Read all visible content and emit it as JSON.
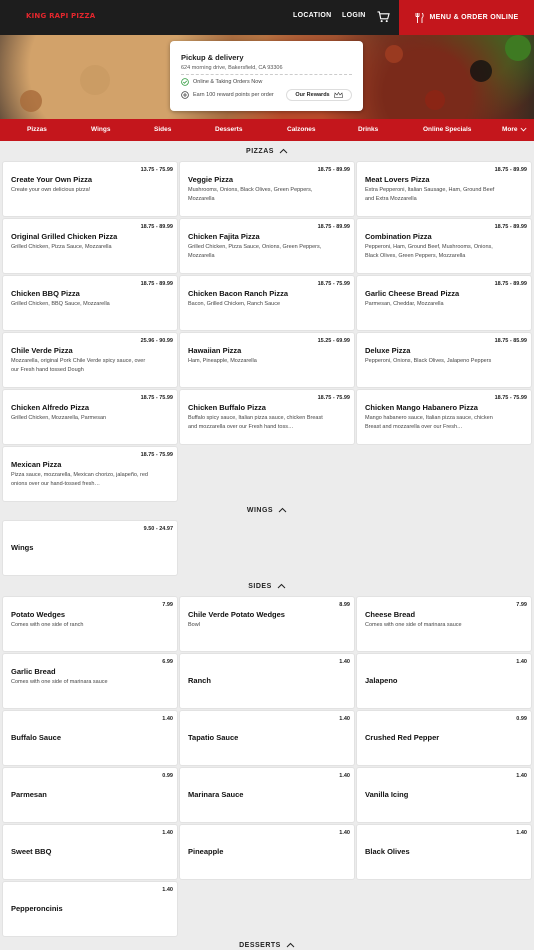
{
  "header": {
    "logo": "KING RAPI PIZZA",
    "nav": [
      "LOCATION",
      "LOGIN"
    ],
    "order_button": "MENU & ORDER ONLINE"
  },
  "store": {
    "title": "Pickup & delivery",
    "address": "624 morning drive, Bakersfield, CA 93306",
    "status": "Online & Taking Orders Now",
    "reward_text": "Earn 100 reward points per order",
    "rewards_button": "Our Rewards"
  },
  "categories": [
    "Pizzas",
    "Wings",
    "Sides",
    "Desserts",
    "Calzones",
    "Drinks",
    "Online Specials",
    "More"
  ],
  "sections": {
    "pizzas": "PIZZAS",
    "wings": "WINGS",
    "sides": "SIDES",
    "desserts": "DESSERTS"
  },
  "pizzas": [
    {
      "name": "Create Your Own Pizza",
      "price": "13.75 - 75.99",
      "desc": "Create your own delicious pizza!"
    },
    {
      "name": "Veggie Pizza",
      "price": "18.75 - 89.99",
      "desc": "Mushrooms, Onions, Black Olives, Green Peppers, Mozzarella"
    },
    {
      "name": "Meat Lovers Pizza",
      "price": "18.75 - 89.99",
      "desc": "Extra Pepperoni, Italian Sausage, Ham, Ground Beef and Extra Mozzarella"
    },
    {
      "name": "Original Grilled Chicken Pizza",
      "price": "18.75 - 89.99",
      "desc": "Grilled Chicken, Pizza Sauce, Mozzarella"
    },
    {
      "name": "Chicken Fajita Pizza",
      "price": "18.75 - 89.99",
      "desc": "Grilled Chicken, Pizza Sauce, Onions, Green Peppers, Mozzarella"
    },
    {
      "name": "Combination Pizza",
      "price": "18.75 - 89.99",
      "desc": "Pepperoni, Ham, Ground Beef, Mushrooms, Onions, Black Olives, Green Peppers, Mozzarella"
    },
    {
      "name": "Chicken BBQ Pizza",
      "price": "18.75 - 89.99",
      "desc": "Grilled Chicken, BBQ Sauce, Mozzarella"
    },
    {
      "name": "Chicken Bacon Ranch Pizza",
      "price": "18.75 - 75.99",
      "desc": "Bacon, Grilled Chicken, Ranch Sauce"
    },
    {
      "name": "Garlic Cheese Bread Pizza",
      "price": "18.75 - 89.99",
      "desc": "Parmesan, Cheddar, Mozzarella"
    },
    {
      "name": "Chile Verde Pizza",
      "price": "25.96 - 90.99",
      "desc": "Mozzarella, original Pork Chile Verde spicy sauce, over our Fresh hand tossed Dough"
    },
    {
      "name": "Hawaiian Pizza",
      "price": "15.25 - 69.99",
      "desc": "Ham, Pineapple, Mozzarella"
    },
    {
      "name": "Deluxe Pizza",
      "price": "18.75 - 85.99",
      "desc": "Pepperoni, Onions, Black Olives, Jalapeno Peppers"
    },
    {
      "name": "Chicken Alfredo Pizza",
      "price": "18.75 - 75.99",
      "desc": "Grilled Chicken, Mozzarella, Parmesan"
    },
    {
      "name": "Chicken Buffalo Pizza",
      "price": "18.75 - 75.99",
      "desc": "Buffalo spicy sauce, Italian pizza sauce, chicken Breast and mozzarella over our Fresh hand toss…"
    },
    {
      "name": "Chicken Mango Habanero Pizza",
      "price": "18.75 - 75.99",
      "desc": "Mango habanero sauce, Italian pizza sauce, chicken Breast and mozzarella over our Fresh…"
    },
    {
      "name": "Mexican Pizza",
      "price": "18.75 - 75.99",
      "desc": "Pizza sauce, mozzarella, Mexican chorizo, jalapeño, red onions over our hand-tossed fresh…"
    }
  ],
  "wings": [
    {
      "name": "Wings",
      "price": "9.50 - 24.97",
      "desc": ""
    }
  ],
  "sides": [
    {
      "name": "Potato Wedges",
      "price": "7.99",
      "desc": "Comes with one side of ranch"
    },
    {
      "name": "Chile Verde Potato Wedges",
      "price": "8.99",
      "desc": "Bowl"
    },
    {
      "name": "Cheese Bread",
      "price": "7.99",
      "desc": "Comes with one side of marinara sauce"
    },
    {
      "name": "Garlic Bread",
      "price": "6.99",
      "desc": "Comes with one side of marinara sauce"
    },
    {
      "name": "Ranch",
      "price": "1.40",
      "desc": ""
    },
    {
      "name": "Jalapeno",
      "price": "1.40",
      "desc": ""
    },
    {
      "name": "Buffalo Sauce",
      "price": "1.40",
      "desc": ""
    },
    {
      "name": "Tapatio Sauce",
      "price": "1.40",
      "desc": ""
    },
    {
      "name": "Crushed Red Pepper",
      "price": "0.99",
      "desc": ""
    },
    {
      "name": "Parmesan",
      "price": "0.99",
      "desc": ""
    },
    {
      "name": "Marinara Sauce",
      "price": "1.40",
      "desc": ""
    },
    {
      "name": "Vanilla Icing",
      "price": "1.40",
      "desc": ""
    },
    {
      "name": "Sweet BBQ",
      "price": "1.40",
      "desc": ""
    },
    {
      "name": "Pineapple",
      "price": "1.40",
      "desc": ""
    },
    {
      "name": "Black Olives",
      "price": "1.40",
      "desc": ""
    },
    {
      "name": "Pepperoncinis",
      "price": "1.40",
      "desc": ""
    }
  ],
  "colors": {
    "brand_red": "#c4161c",
    "topbar": "#1d1d1d",
    "status_green": "#2e9b3d"
  }
}
